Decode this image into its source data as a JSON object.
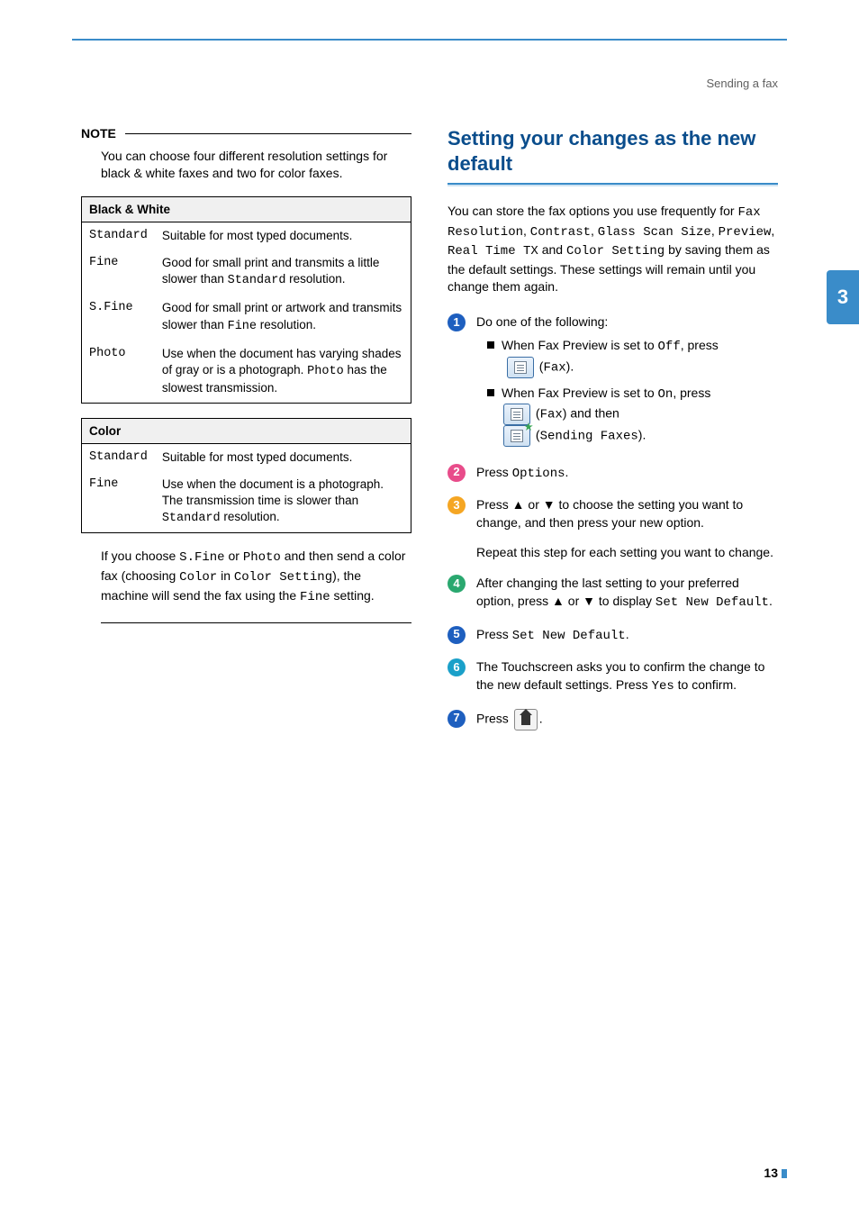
{
  "header": {
    "breadcrumb": "Sending a fax"
  },
  "side_tab": "3",
  "page_number": "13",
  "left": {
    "note_label": "NOTE",
    "note_body": "You can choose four different resolution settings for black & white faxes and two for color faxes.",
    "bw_table": {
      "header": "Black & White",
      "rows": [
        {
          "k": "Standard",
          "v_before": "Suitable for most typed documents."
        },
        {
          "k": "Fine",
          "v_before": "Good for small print and transmits a little slower than ",
          "v_mono": "Standard",
          "v_after": " resolution."
        },
        {
          "k": "S.Fine",
          "v_before": "Good for small print or artwork and transmits slower than ",
          "v_mono": "Fine",
          "v_after": " resolution."
        },
        {
          "k": "Photo",
          "v_before": "Use when the document has varying shades of gray or is a photograph. ",
          "v_mono": "Photo",
          "v_after": " has the slowest transmission."
        }
      ]
    },
    "color_table": {
      "header": "Color",
      "rows": [
        {
          "k": "Standard",
          "v_before": "Suitable for most typed documents."
        },
        {
          "k": "Fine",
          "v_before": "Use when the document is a photograph. The transmission time is slower than ",
          "v_mono": "Standard",
          "v_after": " resolution."
        }
      ]
    },
    "foot": {
      "a": "If you choose ",
      "m1": "S.Fine",
      "b": " or ",
      "m2": "Photo",
      "c": " and then send a color fax (choosing ",
      "m3": "Color",
      "d": " in ",
      "m4": "Color Setting",
      "e": "), the machine will send the fax using the ",
      "m5": "Fine",
      "f": " setting."
    }
  },
  "right": {
    "title": "Setting your changes as the new default",
    "intro": {
      "a": "You can store the fax options you use frequently for ",
      "m1": "Fax Resolution",
      "b": ", ",
      "m2": "Contrast",
      "c": ", ",
      "m3": "Glass Scan Size",
      "d": ", ",
      "m4": "Preview",
      "e": ", ",
      "m5": "Real Time TX",
      "f": " and ",
      "m6": "Color Setting",
      "g": " by saving them as the default settings. These settings will remain until you change them again."
    },
    "step1": {
      "lead": "Do one of the following:",
      "b1a": "When Fax Preview is set to ",
      "b1m": "Off",
      "b1b": ", press ",
      "b1p": " (",
      "b1mm": "Fax",
      "b1c": ").",
      "b2a": "When Fax Preview is set to ",
      "b2m": "On",
      "b2b": ", press ",
      "b2p": " (",
      "b2mm": "Fax",
      "b2c": ") and then ",
      "b2pp": " (",
      "b2mm2": "Sending Faxes",
      "b2cc": ")."
    },
    "step2": {
      "a": "Press ",
      "m": "Options",
      "b": "."
    },
    "step3": {
      "a": "Press ▲ or ▼ to choose the setting you want to change, and then press your new option.",
      "b": "Repeat this step for each setting you want to change."
    },
    "step4": {
      "a": "After changing the last setting to your preferred option, press ▲ or ▼ to display ",
      "m": "Set New Default",
      "b": "."
    },
    "step5": {
      "a": "Press ",
      "m": "Set New Default",
      "b": "."
    },
    "step6": {
      "a": "The Touchscreen asks you to confirm the change to the new default settings. Press ",
      "m": "Yes",
      "b": " to confirm."
    },
    "step7": {
      "a": "Press ",
      "b": "."
    }
  }
}
